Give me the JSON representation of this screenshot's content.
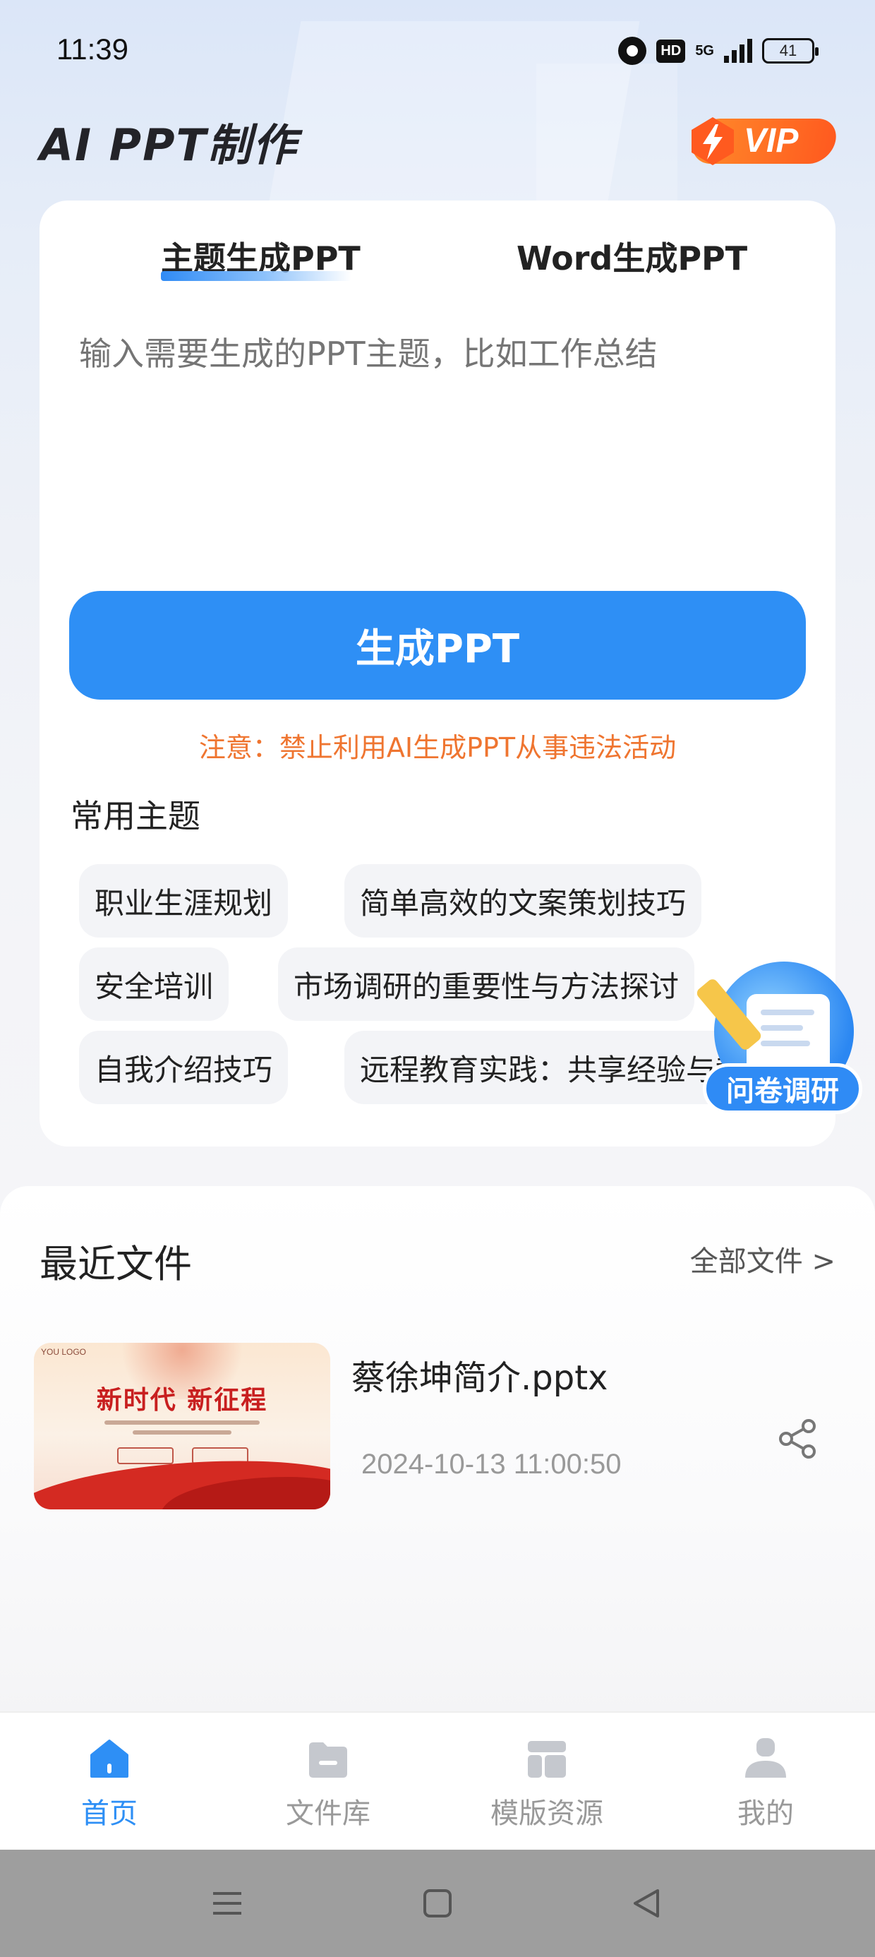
{
  "status_bar": {
    "time": "11:39",
    "hd_label": "HD",
    "network_label": "5G",
    "battery_level": "41"
  },
  "header": {
    "app_title": "AI PPT制作",
    "vip_label": "VIP",
    "vip_color": "#ff6a22"
  },
  "generator": {
    "tabs": [
      {
        "label": "主题生成PPT",
        "active": true
      },
      {
        "label": "Word生成PPT",
        "active": false
      }
    ],
    "topic_placeholder": "输入需要生成的PPT主题，比如工作总结",
    "topic_value": "",
    "generate_button_label": "生成PPT",
    "notice": "注意：禁止利用AI生成PPT从事违法活动",
    "accent_color": "#2e8ff5",
    "notice_color": "#ef7530"
  },
  "common_topics": {
    "title": "常用主题",
    "items": [
      "职业生涯规划",
      "简单高效的文案策划技巧",
      "安全培训",
      "市场调研的重要性与方法探讨",
      "自我介绍技巧",
      "远程教育实践：共享经验与教学"
    ]
  },
  "survey_float": {
    "label": "问卷调研"
  },
  "recent_files": {
    "title": "最近文件",
    "all_files_link": "全部文件 >",
    "files": [
      {
        "name": "蔡徐坤简介.pptx",
        "date": "2024-10-13 11:00:50",
        "thumbnail": {
          "logo_text": "YOU LOGO",
          "heading": "新时代  新征程"
        }
      }
    ]
  },
  "bottom_nav": {
    "items": [
      {
        "label": "首页",
        "icon": "home-icon",
        "active": true
      },
      {
        "label": "文件库",
        "icon": "folder-icon",
        "active": false
      },
      {
        "label": "模版资源",
        "icon": "template-icon",
        "active": false
      },
      {
        "label": "我的",
        "icon": "profile-icon",
        "active": false
      }
    ]
  },
  "system_nav": {
    "icons": [
      "menu-icon",
      "home-square-icon",
      "back-triangle-icon"
    ]
  }
}
